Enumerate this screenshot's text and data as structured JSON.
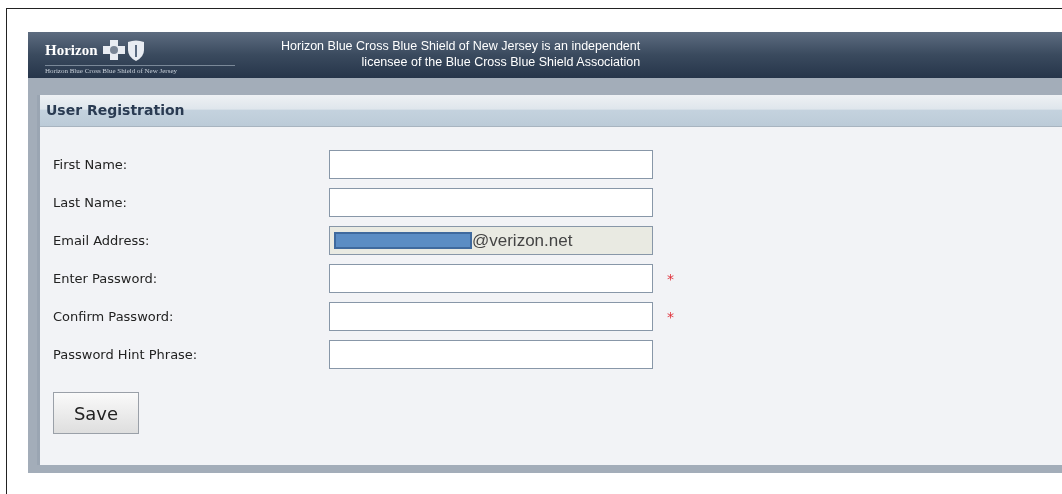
{
  "header": {
    "logo_text": "Horizon",
    "logo_subtext": "Horizon Blue Cross Blue Shield of New Jersey",
    "notice_lines": [
      "Horizon Blue Cross Blue Shield of New Jersey is an independent",
      "licensee of the Blue Cross Blue Shield Association"
    ]
  },
  "panel": {
    "title": "User Registration"
  },
  "fields": [
    {
      "label": "First Name:",
      "disabled": false,
      "redacted": false
    },
    {
      "label": "Last Name:",
      "disabled": false,
      "redacted": false
    },
    {
      "label": "Email Address:",
      "value": "@verizon.net",
      "disabled": true,
      "redacted": true
    },
    {
      "label": "Enter Password:",
      "disabled": false,
      "redacted": false,
      "required_mark": "*"
    },
    {
      "label": "Confirm Password:",
      "disabled": false,
      "redacted": false,
      "required_mark": "*"
    },
    {
      "label": "Password Hint Phrase:",
      "disabled": false,
      "redacted": false
    }
  ],
  "buttons": [
    "Save"
  ]
}
